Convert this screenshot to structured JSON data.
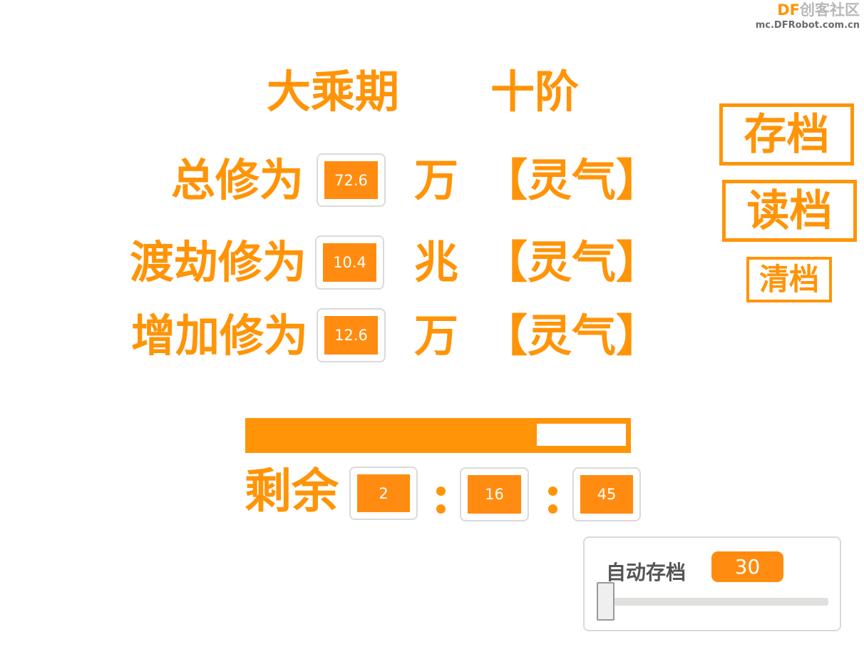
{
  "watermark": {
    "brand_df": "DF",
    "brand_rest": "创客社区",
    "url": "mc.DFRobot.com.cn"
  },
  "header": {
    "realm": "大乘期",
    "rank": "十阶"
  },
  "rows": [
    {
      "label": "总修为",
      "value": "72.6",
      "unit": "万",
      "type": "【灵气】"
    },
    {
      "label": "渡劫修为",
      "value": "10.4",
      "unit": "兆",
      "type": "【灵气】"
    },
    {
      "label": "增加修为",
      "value": "12.6",
      "unit": "万",
      "type": "【灵气】"
    }
  ],
  "buttons": {
    "save": "存档",
    "load": "读档",
    "clear": "清档"
  },
  "progress": {
    "fraction": 0.75
  },
  "timer": {
    "label": "剩余",
    "hours": "2",
    "minutes": "16",
    "seconds": "45"
  },
  "autosave": {
    "label": "自动存档",
    "value": "30",
    "slider_fraction": 0.0
  },
  "colors": {
    "accent": "#ff9408",
    "box_fill": "#ff8c10"
  }
}
